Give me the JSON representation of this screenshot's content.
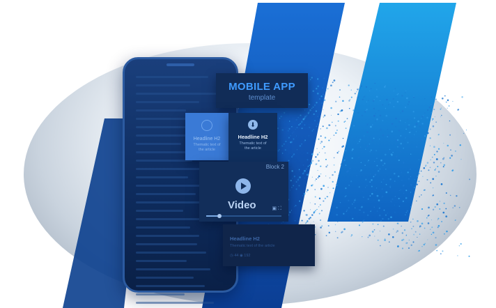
{
  "title_card": {
    "title": "MOBILE APP",
    "subtitle": "template"
  },
  "left_card": {
    "headline": "Headline H2",
    "text_line1": "Thematic text of",
    "text_line2": "the article"
  },
  "headline_card": {
    "icon": "download-icon",
    "headline": "Headline H2",
    "text_line1": "Thematic text of",
    "text_line2": "the article"
  },
  "video_card": {
    "block_label": "Block 2",
    "video_label": "Video",
    "progress": 0.15,
    "icons": [
      "subtitles-icon",
      "fullscreen-icon"
    ]
  },
  "bottom_card": {
    "headline": "Headline H2",
    "text": "Thematic text of the article",
    "meta": "◷ 44  ◉ 192"
  },
  "colors": {
    "accent": "#3f9bff",
    "stripe_light": "#1d9ee6",
    "stripe_dark": "#0d54b8",
    "phone_body": "#0e2c5e"
  }
}
